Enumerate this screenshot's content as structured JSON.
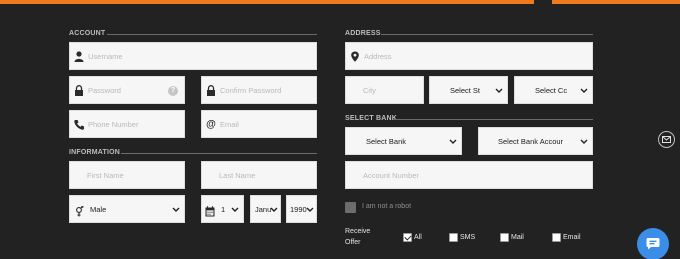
{
  "sections": {
    "account": "ACCOUNT",
    "information": "INFORMATION",
    "address": "ADDRESS",
    "select_bank": "SELECT BANK"
  },
  "account": {
    "username_placeholder": "Username",
    "password_placeholder": "Password",
    "password_help": "?",
    "confirm_password_placeholder": "Confirm Password",
    "phone_placeholder": "Phone Number",
    "email_placeholder": "Email"
  },
  "information": {
    "first_name_placeholder": "First Name",
    "last_name_placeholder": "Last Name",
    "gender_value": "Male",
    "day_value": "1",
    "month_value": "Janu",
    "year_value": "1990"
  },
  "address": {
    "address_placeholder": "Address",
    "city_placeholder": "City",
    "state_value": "Select St",
    "country_value": "Select Cc"
  },
  "bank": {
    "bank_value": "Select Bank",
    "account_type_value": "Select Bank Accour",
    "account_number_placeholder": "Account Number"
  },
  "captcha": {
    "label": "I am not a robot",
    "checked": false
  },
  "receive_offer": {
    "label_line1": "Receive",
    "label_line2": "Offer",
    "options": [
      {
        "label": "All",
        "checked": true
      },
      {
        "label": "SMS",
        "checked": false
      },
      {
        "label": "Mail",
        "checked": false
      },
      {
        "label": "Email",
        "checked": false
      }
    ]
  },
  "icons": {
    "user": "user-icon",
    "lock": "lock-icon",
    "phone": "phone-icon",
    "at": "at-sign-icon",
    "gender": "gender-icon",
    "calendar": "calendar-icon",
    "pin": "map-pin-icon",
    "mail": "mail-icon",
    "chat": "chat-icon"
  },
  "colors": {
    "background": "#222222",
    "accent_bar": "#f07a1e",
    "field_bg": "#f6f6f6",
    "chat_button": "#3a8ee8"
  }
}
